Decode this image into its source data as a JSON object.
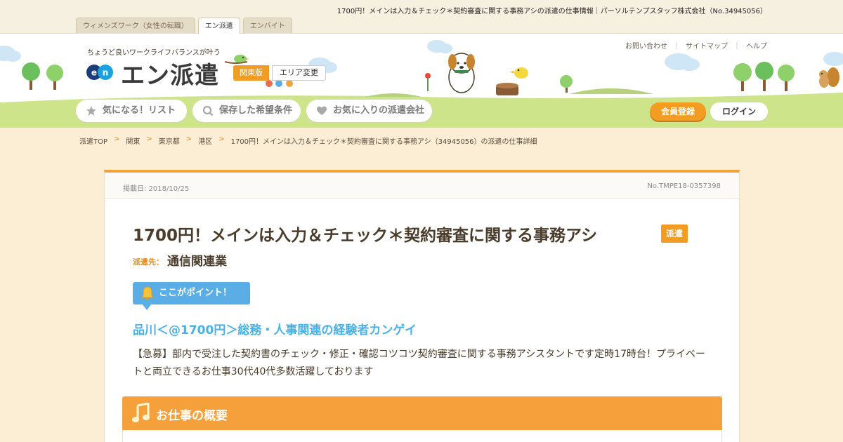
{
  "page_heading": "1700円！メインは入力＆チェック＊契約審査に関する事務アシの派遣の仕事情報｜パーソルテンプスタッフ株式会社（No.34945056）",
  "site_tabs": [
    {
      "label": "ウィメンズワーク（女性の転職）",
      "active": false
    },
    {
      "label": "エン派遣",
      "active": true
    },
    {
      "label": "エンバイト",
      "active": false
    }
  ],
  "header": {
    "tagline": "ちょうど良いワークライフバランスが叶う",
    "logo_mark": "en",
    "logo_text": "エン派遣",
    "region": "関東版",
    "area_change": "エリア変更",
    "util_links": [
      "お問い合わせ",
      "サイトマップ",
      "ヘルプ"
    ],
    "util_sep": "｜",
    "nav": [
      {
        "label": "気になる！リスト",
        "icon": "star-icon"
      },
      {
        "label": "保存した希望条件",
        "icon": "search-icon"
      },
      {
        "label": "お気に入りの派遣会社",
        "icon": "heart-icon"
      }
    ],
    "register_label": "会員登録",
    "login_label": "ログイン"
  },
  "breadcrumb": {
    "items": [
      "派遣TOP",
      "関東",
      "東京都",
      "港区",
      "1700円！メインは入力＆チェック＊契約審査に関する事務アシ（34945056）の派遣の仕事詳細"
    ],
    "separator": ">"
  },
  "job": {
    "posted": "掲載日: 2018/10/25",
    "job_no": "No.TMPE18-0357398",
    "title": "1700円！メインは入力＆チェック＊契約審査に関する事務アシ",
    "badge": "派遣",
    "client_label": "派遣先：",
    "client_value": "通信関連業",
    "point_label": "ここがポイント！",
    "catch_copy": "品川＜@1700円＞総務・人事関連の経験者カンゲイ",
    "lead": "【急募】部内で受注した契約書のチェック・修正・確認コツコツ契約審査に関する事務アシスタントです定時17時台！プライベートと両立できるお仕事30代40代多数活躍しております",
    "section_title": "お仕事の概要"
  },
  "colors": {
    "accent_orange": "#f39c24",
    "point_blue": "#5aaee5",
    "catch_blue": "#4cb1e6",
    "background": "#fbeed4",
    "grass": "#cde48b"
  }
}
